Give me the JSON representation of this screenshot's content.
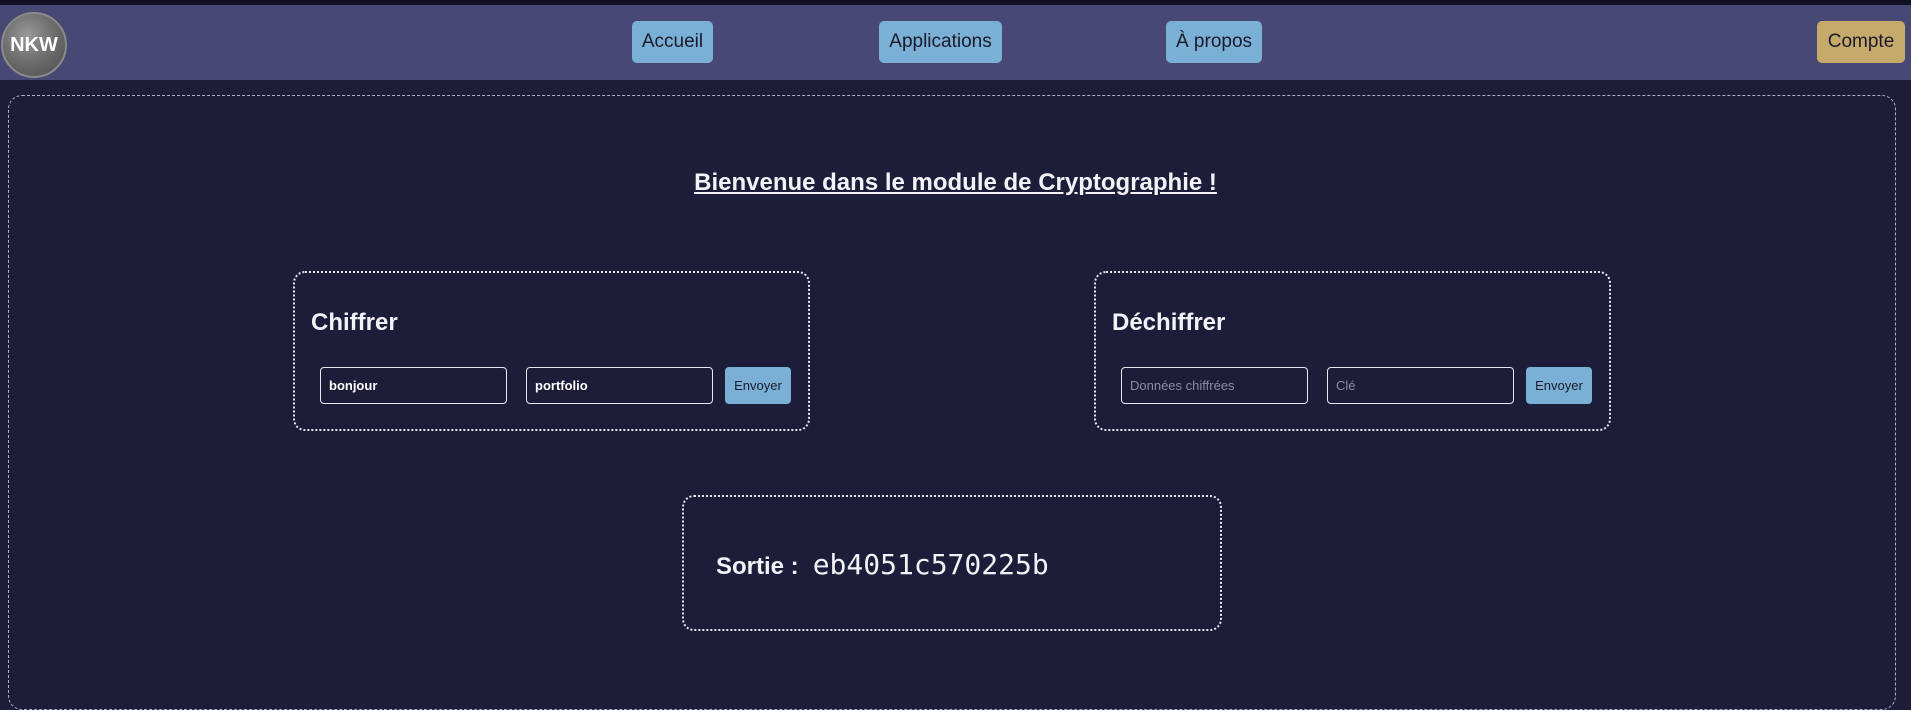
{
  "navbar": {
    "logo_text": "NKW",
    "items": [
      {
        "label": "Accueil"
      },
      {
        "label": "Applications"
      },
      {
        "label": "À propos"
      }
    ],
    "account_label": "Compte",
    "colors": {
      "nav_bg": "#474874",
      "button": "#7ab0d6",
      "account_button": "#c6aa6c"
    }
  },
  "main": {
    "title": "Bienvenue dans le module de Cryptographie !",
    "encrypt": {
      "heading": "Chiffrer",
      "data_value": "bonjour",
      "key_value": "portfolio",
      "submit_label": "Envoyer"
    },
    "decrypt": {
      "heading": "Déchiffrer",
      "data_placeholder": "Données chiffrées",
      "key_placeholder": "Clé",
      "submit_label": "Envoyer"
    },
    "output": {
      "label": "Sortie :",
      "value": "eb4051c570225b"
    },
    "colors": {
      "page_bg": "#1c1d38"
    }
  }
}
